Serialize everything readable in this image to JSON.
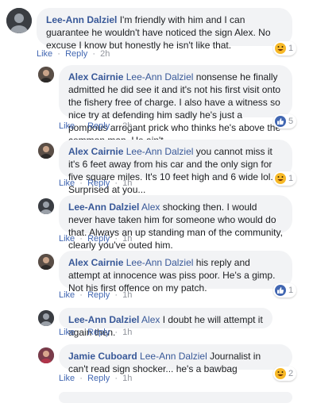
{
  "comments": [
    {
      "author": "Lee-Ann Dalziel",
      "mention": "",
      "text": "I'm friendly with him and I can guarantee he wouldn't have noticed the sign Alex. No excuse I know but honestly he isn't like that.",
      "like_label": "Like",
      "reply_label": "Reply",
      "time": "2h",
      "reaction_type": "haha",
      "reaction_count": "1"
    },
    {
      "author": "Alex Cairnie",
      "mention": "Lee-Ann Dalziel",
      "text": "nonsense he finally admitted he did see it and it's not his first visit onto the fishery free of charge. I also have a witness so nice try at defending him sadly he's just a pompous arrogant prick who thinks he's above the common man. He ain't",
      "like_label": "Like",
      "reply_label": "Reply",
      "time": "2h",
      "reaction_type": "like",
      "reaction_count": "5"
    },
    {
      "author": "Alex Cairnie",
      "mention": "Lee-Ann Dalziel",
      "text": "you cannot miss it it's 6 feet away from his car and the only sign for five square miles. It's 10 feet high and 6 wide lol. Surprised at you...",
      "like_label": "Like",
      "reply_label": "Reply",
      "time": "1h",
      "reaction_type": "haha",
      "reaction_count": "1"
    },
    {
      "author": "Lee-Ann Dalziel",
      "mention": "Alex",
      "text": "shocking then. I would never have taken him for someone who would do that. Always an up standing man of the community, clearly you've outed him.",
      "like_label": "Like",
      "reply_label": "Reply",
      "time": "1h",
      "reaction_type": "",
      "reaction_count": ""
    },
    {
      "author": "Alex Cairnie",
      "mention": "Lee-Ann Dalziel",
      "text": "his reply and attempt at innocence was piss poor. He's a gimp. Not his first offence on my patch.",
      "like_label": "Like",
      "reply_label": "Reply",
      "time": "1h",
      "reaction_type": "like",
      "reaction_count": "1"
    },
    {
      "author": "Lee-Ann Dalziel",
      "mention": "Alex",
      "text": "I doubt he will attempt it again then.",
      "like_label": "Like",
      "reply_label": "Reply",
      "time": "1h",
      "reaction_type": "",
      "reaction_count": ""
    },
    {
      "author": "Jamie Cuboard",
      "mention": "Lee-Ann Dalziel",
      "text": "Journalist in can't read sign shocker... he's a bawbag",
      "like_label": "Like",
      "reply_label": "Reply",
      "time": "1h",
      "reaction_type": "haha",
      "reaction_count": "2"
    }
  ],
  "separator": "·",
  "colors": {
    "link": "#385898",
    "bubble": "#f2f3f5",
    "haha": "#f7b928",
    "like": "#4267b2"
  }
}
